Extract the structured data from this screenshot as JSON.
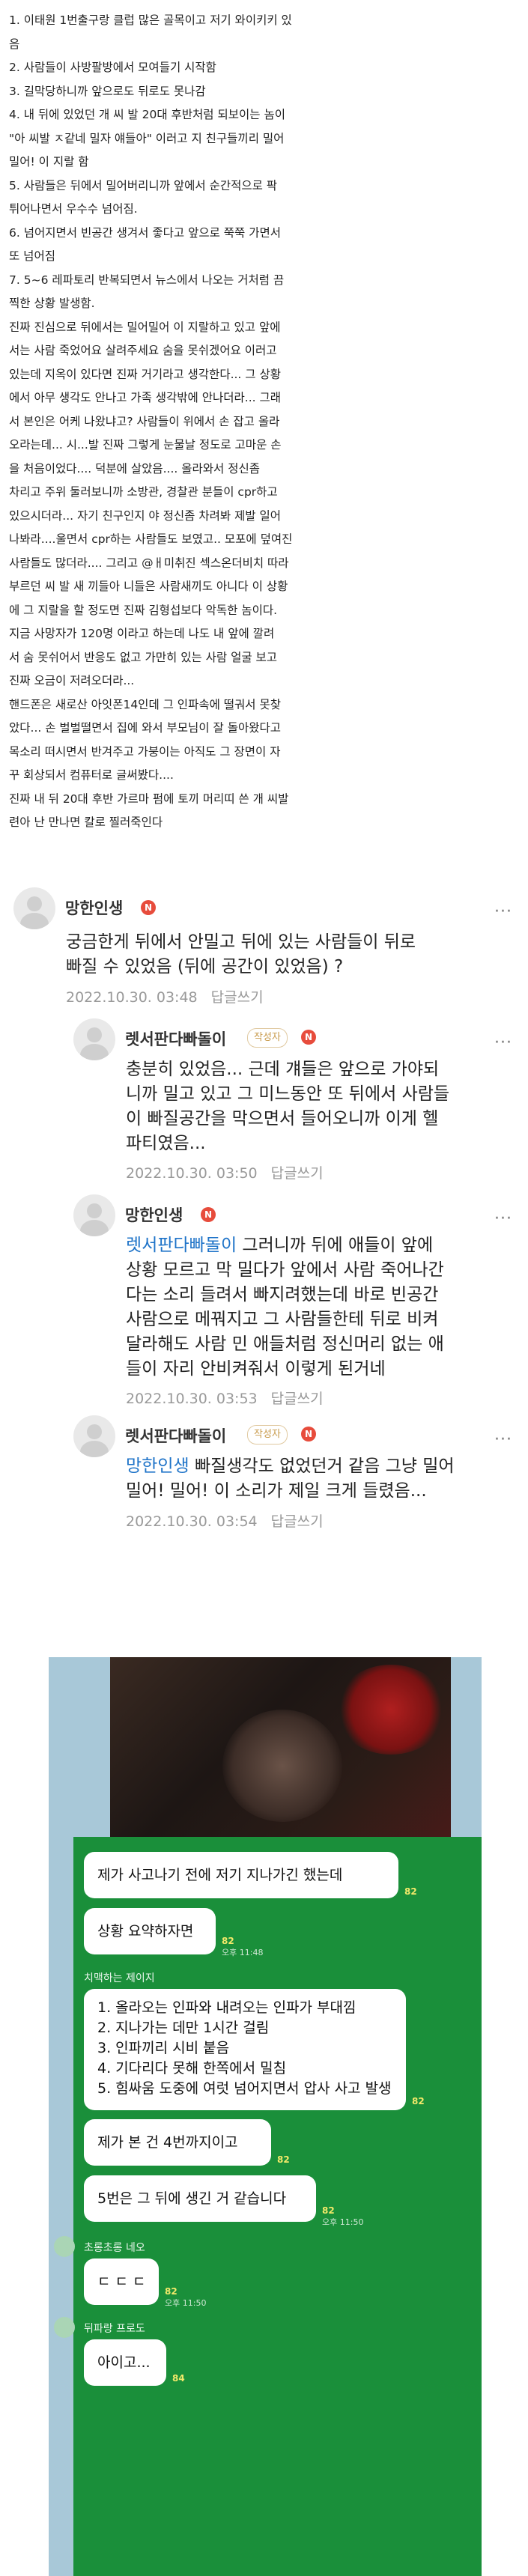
{
  "story": {
    "lines": [
      "1. 이태원 1번출구랑 클럽 많은 골목이고 저기 와이키키 있",
      "음",
      "2. 사람들이 사방팔방에서 모여들기 시작함",
      "3. 길막당하니까 앞으로도 뒤로도 못나감",
      "4. 내 뒤에 있었던 개 씨 발 20대 후반처럼 되보이는 놈이",
      "\"아 씨발 ㅈ같네 밀자 얘들아\" 이러고 지 친구들끼리 밀어",
      "밀어! 이 지랄 함",
      "5. 사람들은 뒤에서 밀어버리니까 앞에서 순간적으로 팍",
      "튀어나면서 우수수 넘어짐.",
      "6. 넘어지면서 빈공간 생겨서 좋다고 앞으로 쭉쭉 가면서",
      "또 넘어짐",
      "7. 5~6 레파토리 반복되면서 뉴스에서 나오는 거처럼 끔",
      "찍한 상황 발생함.",
      "진짜 진심으로 뒤에서는 밀어밀어 이 지랄하고 있고 앞에",
      "서는 사람 죽었어요 살려주세요 숨을 못쉬겠어요 이러고",
      "있는데 지옥이 있다면 진짜 거기라고 생각한다... 그 상황",
      "에서 아무 생각도 안나고 가족 생각밖에 안나더라... 그래",
      "서 본인은 어케 나왔냐고? 사람들이 위에서 손 잡고 올라",
      "오라는데... 시...발 진짜 그렇게 눈물날 정도로 고마운 손",
      "을 처음이었다.... 덕분에 살았음.... 올라와서 정신좀",
      "차리고 주위 둘러보니까 소방관, 경찰관 분들이 cpr하고",
      "있으시더라... 자기 친구인지 야 정신좀 차려봐 제발 일어",
      "나봐라....울면서 cpr하는 사람들도 보였고.. 모포에 덮여진",
      "사람들도 많더라.... 그리고 @ㅐ미취진 섹스온더비치 따라",
      "부르던 씨 발 새 끼들아 니들은 사람새끼도 아니다 이 상황",
      "에 그 지랄을 할 정도면 진짜 김형섭보다 악독한 놈이다.",
      "지금 사망자가 120명 이라고 하는데 나도 내 앞에 깔려",
      "서 숨 못쉬어서 반응도 없고 가만히 있는 사람 얼굴 보고",
      "진짜 오금이 저려오더라...",
      "핸드폰은 새로산 아잇폰14인데 그 인파속에 떨궈서 못찾",
      "았다... 손 벌벌떨면서 집에 와서 부모님이 잘 돌아왔다고",
      "목소리 떠시면서 반겨주고 가붕이는 아직도 그 장면이 자",
      "꾸 회상되서 컴퓨터로 글써봤다....",
      "진짜 내 뒤 20대 후반 가르마 펌에 토끼 머리띠 쓴 개 씨발",
      "련아 난 만나면 칼로 찔러죽인다"
    ]
  },
  "comments": [
    {
      "nickname": "망한인생",
      "badge_n": "N",
      "writer_badge": "",
      "more_label": "···",
      "mention": "",
      "lines": [
        "궁금한게 뒤에서 안밀고 뒤에 있는 사람들이 뒤로",
        "빠질 수 있었음 (뒤에 공간이 있었음) ?"
      ],
      "date": "2022.10.30. 03:48",
      "reply_label": "답글쓰기"
    },
    {
      "nickname": "렛서판다빠돌이",
      "badge_n": "N",
      "writer_badge": "작성자",
      "more_label": "···",
      "mention": "",
      "lines": [
        "충분히 있었음... 근데 걔들은 앞으로 가야되",
        "니까 밀고 있고 그 미느동안 또 뒤에서 사람들",
        "이 빠질공간을 막으면서 들어오니까 이게 헬",
        "파티였음..."
      ],
      "date": "2022.10.30. 03:50",
      "reply_label": "답글쓰기"
    },
    {
      "nickname": "망한인생",
      "badge_n": "N",
      "writer_badge": "",
      "more_label": "···",
      "mention": "렛서판다빠돌이",
      "lines": [
        " 그러니까 뒤에 애들이 앞에",
        "상황 모르고 막 밀다가 앞에서 사람 죽어나간",
        "다는 소리 들려서 빠지려했는데 바로 빈공간",
        "사람으로 메꿔지고 그 사람들한테 뒤로 비켜",
        "달라해도 사람 민 애들처럼 정신머리 없는 애",
        "들이 자리 안비켜줘서 이렇게 된거네"
      ],
      "date": "2022.10.30. 03:53",
      "reply_label": "답글쓰기"
    },
    {
      "nickname": "렛서판다빠돌이",
      "badge_n": "N",
      "writer_badge": "작성자",
      "more_label": "···",
      "mention": "망한인생",
      "lines": [
        " 빠질생각도 없었던거 같음 그냥 밀어",
        "밀어! 밀어! 이 소리가 제일 크게 들렸음..."
      ],
      "date": "2022.10.30. 03:54",
      "reply_label": "답글쓰기"
    }
  ],
  "chat": {
    "messages": [
      {
        "type": "bubble",
        "text": "제가 사고나기 전에 저기 지나가긴 했는데",
        "count": "82",
        "time": ""
      },
      {
        "type": "bubble",
        "text": "상황 요약하자면",
        "count": "82",
        "time": "오후 11:48"
      },
      {
        "type": "sender",
        "name": "치맥하는 제이지"
      },
      {
        "type": "multi",
        "lines": [
          "1. 올라오는 인파와 내려오는 인파가 부대낌",
          "2. 지나가는 데만 1시간 걸림",
          "3. 인파끼리 시비 붙음",
          "4. 기다리다 못해 한쪽에서 밀침",
          "5. 힘싸움 도중에 여럿 넘어지면서 압사 사고 발생"
        ],
        "count": "82",
        "time": ""
      },
      {
        "type": "bubble",
        "text": "제가 본 건 4번까지이고",
        "count": "82",
        "time": ""
      },
      {
        "type": "bubble",
        "text": "5번은 그 뒤에 생긴 거 같습니다",
        "count": "82",
        "time": "오후 11:50"
      },
      {
        "type": "sender",
        "name": "초롱초롱 네오"
      },
      {
        "type": "bubble",
        "text": "ㄷㄷㄷ",
        "count": "82",
        "time": "오후 11:50"
      },
      {
        "type": "sender",
        "name": "뒤파랑 프로도"
      },
      {
        "type": "bubble",
        "text": "아이고...",
        "count": "84",
        "time": ""
      }
    ]
  },
  "colors": {
    "chat_green": "#1a8f3a",
    "chat_bg": "#a8c8d8",
    "mention_blue": "#1e73c8",
    "badge_red": "#e74c3c",
    "meta_gray": "#999999"
  }
}
